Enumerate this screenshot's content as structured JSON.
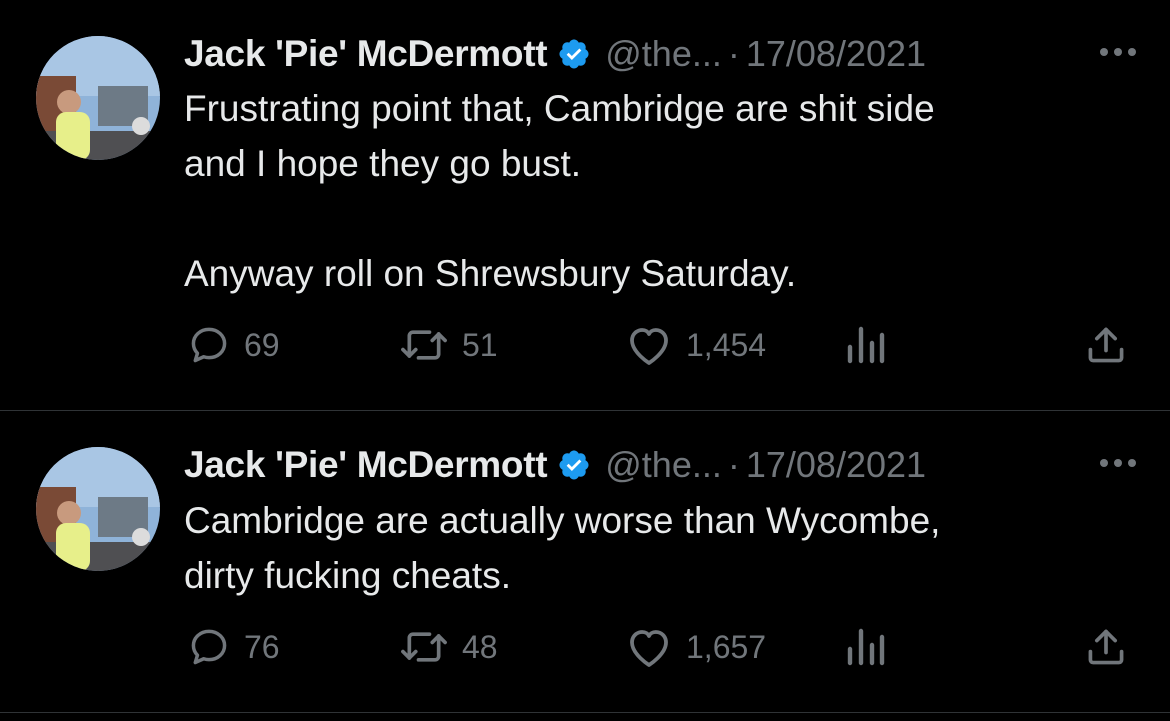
{
  "tweets": [
    {
      "name": "Jack 'Pie' McDermott",
      "handle": "@the...",
      "separator": "·",
      "date": "17/08/2021",
      "text": "Frustrating point that, Cambridge are shit side\nand I hope they go bust.\n\nAnyway roll on Shrewsbury Saturday.",
      "replies": "69",
      "retweets": "51",
      "likes": "1,454"
    },
    {
      "name": "Jack 'Pie' McDermott",
      "handle": "@the...",
      "separator": "·",
      "date": "17/08/2021",
      "text": "Cambridge are actually worse than Wycombe,\ndirty fucking cheats.",
      "replies": "76",
      "retweets": "48",
      "likes": "1,657"
    }
  ],
  "colors": {
    "background": "#000000",
    "primary_text": "#e7e9ea",
    "secondary_text": "#71767b",
    "verified_badge": "#1d9bf0",
    "divider": "#2f3336"
  },
  "icons": {
    "reply": "speech-bubble",
    "retweet": "two-arrows-loop",
    "like": "heart-outline",
    "views": "bar-chart",
    "share": "upload-arrow",
    "more": "three-dots",
    "verified": "verified-badge"
  }
}
